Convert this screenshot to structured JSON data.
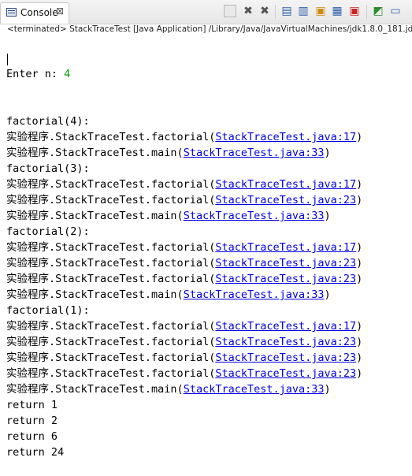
{
  "tab": {
    "label": "Console",
    "close": "⊠"
  },
  "toolbar": {
    "icons": [
      "stop-icon",
      "remove-launch-icon",
      "remove-all-icon",
      "scroll-lock-icon",
      "word-wrap-icon",
      "show-on-stdout-icon",
      "show-on-stderr-icon",
      "pin-console-icon",
      "display-console-icon",
      "new-console-icon"
    ]
  },
  "status_line": "<terminated> StackTraceTest [Java Application] /Library/Java/JavaVirtualMachines/jdk1.8.0_181.jd",
  "prompt": {
    "label": "Enter n: ",
    "value": "4"
  },
  "lines": [
    {
      "text": "factorial(4):"
    },
    {
      "prefix": "实验程序.StackTraceTest.factorial(",
      "link": "StackTraceTest.java:17",
      "suffix": ")"
    },
    {
      "prefix": "实验程序.StackTraceTest.main(",
      "link": "StackTraceTest.java:33",
      "suffix": ")"
    },
    {
      "text": "factorial(3):"
    },
    {
      "prefix": "实验程序.StackTraceTest.factorial(",
      "link": "StackTraceTest.java:17",
      "suffix": ")"
    },
    {
      "prefix": "实验程序.StackTraceTest.factorial(",
      "link": "StackTraceTest.java:23",
      "suffix": ")"
    },
    {
      "prefix": "实验程序.StackTraceTest.main(",
      "link": "StackTraceTest.java:33",
      "suffix": ")"
    },
    {
      "text": "factorial(2):"
    },
    {
      "prefix": "实验程序.StackTraceTest.factorial(",
      "link": "StackTraceTest.java:17",
      "suffix": ")"
    },
    {
      "prefix": "实验程序.StackTraceTest.factorial(",
      "link": "StackTraceTest.java:23",
      "suffix": ")"
    },
    {
      "prefix": "实验程序.StackTraceTest.factorial(",
      "link": "StackTraceTest.java:23",
      "suffix": ")"
    },
    {
      "prefix": "实验程序.StackTraceTest.main(",
      "link": "StackTraceTest.java:33",
      "suffix": ")"
    },
    {
      "text": "factorial(1):"
    },
    {
      "prefix": "实验程序.StackTraceTest.factorial(",
      "link": "StackTraceTest.java:17",
      "suffix": ")"
    },
    {
      "prefix": "实验程序.StackTraceTest.factorial(",
      "link": "StackTraceTest.java:23",
      "suffix": ")"
    },
    {
      "prefix": "实验程序.StackTraceTest.factorial(",
      "link": "StackTraceTest.java:23",
      "suffix": ")"
    },
    {
      "prefix": "实验程序.StackTraceTest.factorial(",
      "link": "StackTraceTest.java:23",
      "suffix": ")"
    },
    {
      "prefix": "实验程序.StackTraceTest.main(",
      "link": "StackTraceTest.java:33",
      "suffix": ")"
    },
    {
      "text": "return 1"
    },
    {
      "text": "return 2"
    },
    {
      "text": "return 6"
    },
    {
      "text": "return 24"
    }
  ],
  "colors": {
    "input": "#00a000",
    "link": "#0000e0"
  }
}
